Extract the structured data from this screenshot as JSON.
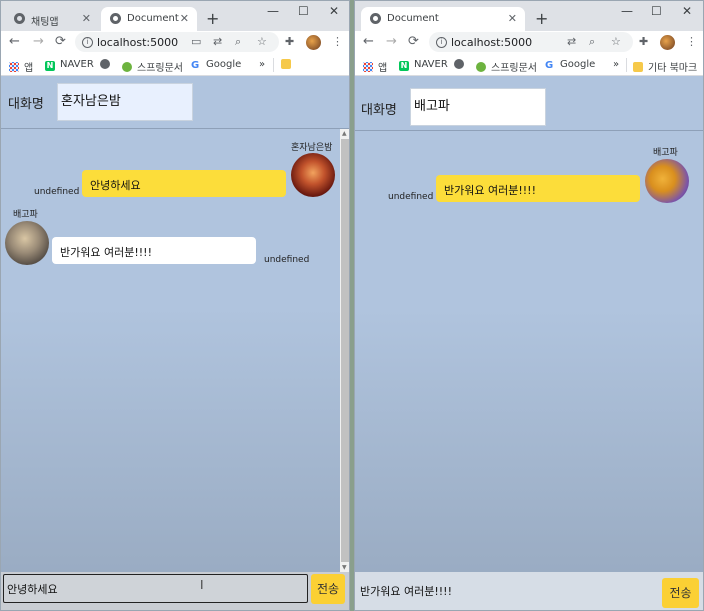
{
  "left_window": {
    "tabs": [
      {
        "title": "채팅앱",
        "close": "✕"
      },
      {
        "title": "Document",
        "close": "✕"
      }
    ],
    "new_tab": "+",
    "window_controls": {
      "minimize": "—",
      "maximize": "☐",
      "close": "✕"
    },
    "url": "localhost:5000",
    "bookmarks": [
      {
        "label": "앱",
        "icon": "apps-icon"
      },
      {
        "label": "NAVER",
        "icon": "naver-icon"
      },
      {
        "label": "",
        "icon": "globe-icon"
      },
      {
        "label": "스프링문서",
        "icon": "spring-icon"
      },
      {
        "label": "Google",
        "icon": "google-icon"
      }
    ],
    "bookmarks_overflow": "»",
    "room_label": "대화명",
    "room_name": "혼자남은밤",
    "messages": [
      {
        "side": "mine",
        "name": "혼자남은밤",
        "text": "안녕하세요",
        "time": "undefined",
        "avatar": "lantern-avatar"
      },
      {
        "side": "other",
        "name": "배고파",
        "text": "반가워요 여러분!!!!",
        "time": "undefined",
        "avatar": "food-avatar"
      }
    ],
    "input_value": "안녕하세요",
    "send_label": "전송"
  },
  "right_window": {
    "tabs": [
      {
        "title": "Document",
        "close": "✕"
      }
    ],
    "new_tab": "+",
    "window_controls": {
      "minimize": "—",
      "maximize": "☐",
      "close": "✕"
    },
    "url": "localhost:5000",
    "bookmarks": [
      {
        "label": "앱",
        "icon": "apps-icon"
      },
      {
        "label": "NAVER",
        "icon": "naver-icon"
      },
      {
        "label": "",
        "icon": "globe-icon"
      },
      {
        "label": "스프링문서",
        "icon": "spring-icon"
      },
      {
        "label": "Google",
        "icon": "google-icon"
      }
    ],
    "bookmarks_overflow": "»",
    "other_bookmarks": "기타 북마크",
    "room_label": "대화명",
    "room_name": "배고파",
    "messages": [
      {
        "side": "mine",
        "name": "배고파",
        "text": "반가워요 여러분!!!!",
        "time": "undefined",
        "avatar": "pumpkin-avatar"
      }
    ],
    "input_value": "반가워요 여러분!!!!",
    "send_label": "전송"
  },
  "icons": {
    "back": "←",
    "forward": "→",
    "reload": "⟳",
    "info": "i",
    "translate": "⇄",
    "zoom": "⌕",
    "star": "☆",
    "extension": "✚",
    "menu": "⋮",
    "cast": "▭",
    "ibeam": "I",
    "scroll_up": "▲",
    "scroll_down": "▼"
  },
  "colors": {
    "page_bg": "#b0c4de",
    "my_bubble": "#fcdd3a",
    "other_bubble": "#ffffff",
    "send_button": "#fbd034"
  }
}
